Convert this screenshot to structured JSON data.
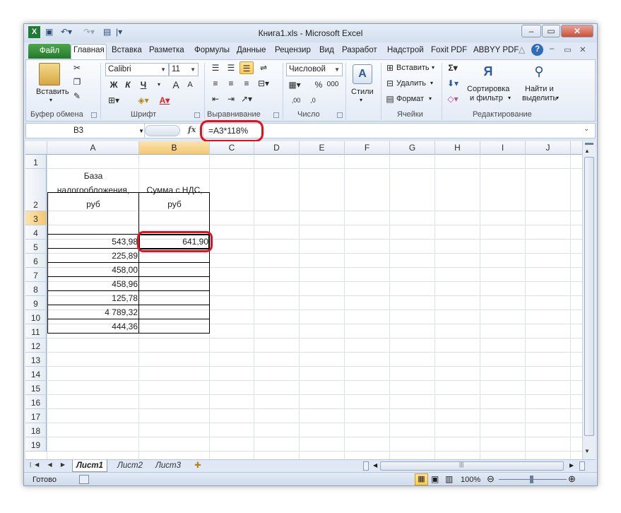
{
  "window": {
    "title": "Книга1.xls - Microsoft Excel",
    "controls": {
      "minimize": "–",
      "restore": "▭",
      "close": "✕"
    }
  },
  "ribbon_tabs": [
    {
      "label": "Файл"
    },
    {
      "label": "Главная"
    },
    {
      "label": "Вставка"
    },
    {
      "label": "Разметка"
    },
    {
      "label": "Формулы"
    },
    {
      "label": "Данные"
    },
    {
      "label": "Рецензир"
    },
    {
      "label": "Вид"
    },
    {
      "label": "Разработ"
    },
    {
      "label": "Надстрой"
    },
    {
      "label": "Foxit PDF"
    },
    {
      "label": "ABBYY PDF"
    }
  ],
  "ribbon": {
    "clipboard": {
      "paste": "Вставить",
      "label": "Буфер обмена"
    },
    "font": {
      "name": "Calibri",
      "size": "11",
      "bold": "Ж",
      "italic": "К",
      "underline": "Ч",
      "grow": "A",
      "shrink": "A",
      "label": "Шрифт"
    },
    "alignment": {
      "label": "Выравнивание"
    },
    "number": {
      "format": "Числовой",
      "label": "Число"
    },
    "styles": {
      "button": "Стили"
    },
    "cells": {
      "insert": "Вставить",
      "delete": "Удалить",
      "format": "Формат",
      "label": "Ячейки"
    },
    "editing": {
      "sort": "Сортировка",
      "sort2": "и фильтр",
      "find": "Найти и",
      "find2": "выделить",
      "label": "Редактирование"
    }
  },
  "formula_bar": {
    "name_box": "B3",
    "fx": "fx",
    "formula": "=A3*118%"
  },
  "sheet": {
    "columns": [
      "A",
      "B",
      "C",
      "D",
      "E",
      "F",
      "G",
      "H",
      "I",
      "J"
    ],
    "rows": [
      "1",
      "2",
      "3",
      "4",
      "5",
      "6",
      "7",
      "8",
      "9",
      "10",
      "11",
      "12",
      "13",
      "14",
      "15",
      "16",
      "17",
      "18",
      "19"
    ],
    "header_a": [
      "База",
      "налогообложения,",
      "руб"
    ],
    "header_b": [
      "Сумма с НДС,",
      "руб"
    ],
    "values_a": [
      "543,98",
      "225,89",
      "458,00",
      "458,96",
      "125,78",
      "4 789,32",
      "444,36"
    ],
    "values_b": [
      "641,90"
    ]
  },
  "sheet_tabs": [
    "Лист1",
    "Лист2",
    "Лист3"
  ],
  "status": {
    "ready": "Готово",
    "zoom": "100%"
  },
  "colors": {
    "highlight": "#e3101d",
    "file_tab": "#2a8a32",
    "selected_header": "#f5c76f"
  }
}
